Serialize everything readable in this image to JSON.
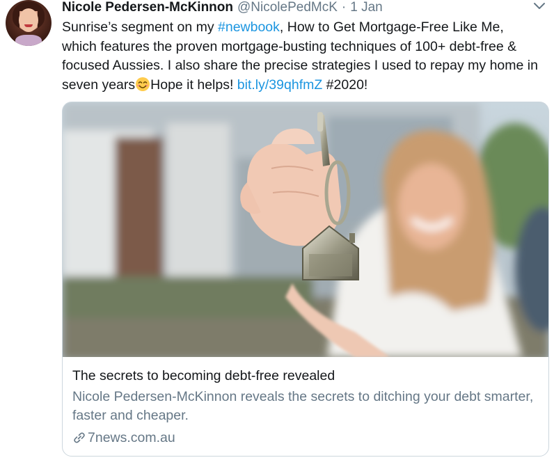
{
  "author": {
    "display_name": "Nicole Pedersen-McKinnon",
    "handle": "@NicolePedMcK",
    "separator": "·",
    "timestamp": "1 Jan"
  },
  "tweet": {
    "text_part1": "Sunrise’s segment on my ",
    "hashtag_newbook": "#newbook",
    "text_part2": ", How to Get Mortgage-Free Like Me, which features the proven mortgage-busting techniques of 100+ debt-free & focused Aussies. I also share the precise strategies I used to repay my home in seven years",
    "emoji_name": "smiling-face-with-smiling-eyes",
    "text_part3": "Hope it helps! ",
    "link": "bit.ly/39qhfmZ",
    "text_part4": " #2020!"
  },
  "card": {
    "title": "The secrets to becoming debt-free revealed",
    "description": "Nicole Pedersen-McKinnon reveals the secrets to ditching your debt smarter, faster and cheaper.",
    "domain": "7news.com.au",
    "domain_icon": "link-icon"
  },
  "icons": {
    "menu": "chevron-down-icon"
  },
  "colors": {
    "link": "#1b95e0",
    "secondary_text": "#657786",
    "border": "#ccd6dd"
  }
}
